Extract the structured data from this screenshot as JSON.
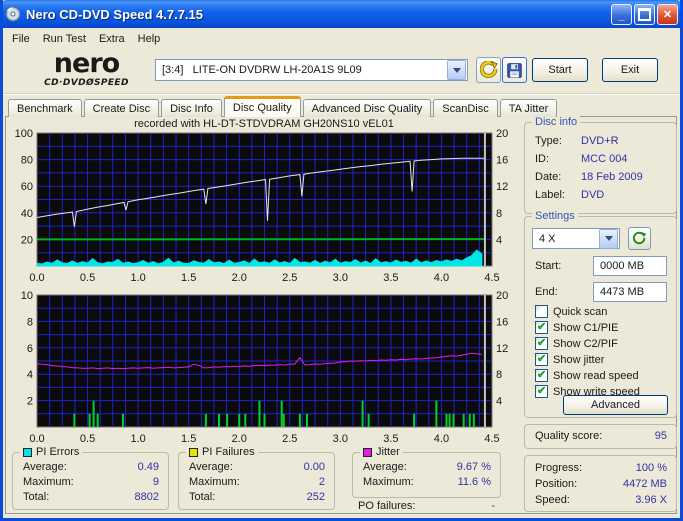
{
  "window": {
    "title": "Nero CD-DVD Speed 4.7.7.15"
  },
  "menu": {
    "items": [
      "File",
      "Run Test",
      "Extra",
      "Help"
    ]
  },
  "header": {
    "logo_title": "nero",
    "logo_subtitle": "CD·DVDØSPEED",
    "drive_select": "[3:4]   LITE-ON DVDRW LH-20A1S 9L09",
    "start_label": "Start",
    "exit_label": "Exit"
  },
  "tabs": {
    "items": [
      {
        "label": "Benchmark",
        "active": false
      },
      {
        "label": "Create Disc",
        "active": false
      },
      {
        "label": "Disc Info",
        "active": false
      },
      {
        "label": "Disc Quality",
        "active": true
      },
      {
        "label": "Advanced Disc Quality",
        "active": false
      },
      {
        "label": "ScanDisc",
        "active": false
      },
      {
        "label": "TA Jitter",
        "active": false
      }
    ]
  },
  "disc_info": {
    "caption": "Disc info",
    "rows": [
      {
        "label": "Type:",
        "value": "DVD+R"
      },
      {
        "label": "ID:",
        "value": "MCC 004"
      },
      {
        "label": "Date:",
        "value": "18 Feb 2009"
      },
      {
        "label": "Label:",
        "value": "DVD"
      }
    ]
  },
  "settings": {
    "caption": "Settings",
    "speed_value": "4 X",
    "start_label": "Start:",
    "start_value": "0000 MB",
    "end_label": "End:",
    "end_value": "4473 MB",
    "checkboxes": [
      {
        "label": "Quick scan",
        "checked": false
      },
      {
        "label": "Show C1/PIE",
        "checked": true
      },
      {
        "label": "Show C2/PIF",
        "checked": true
      },
      {
        "label": "Show jitter",
        "checked": true
      },
      {
        "label": "Show read speed",
        "checked": true
      },
      {
        "label": "Show write speed",
        "checked": true
      }
    ],
    "advanced_label": "Advanced"
  },
  "quality": {
    "label": "Quality score:",
    "value": "95"
  },
  "progress": {
    "rows": [
      {
        "label": "Progress:",
        "value": "100 %"
      },
      {
        "label": "Position:",
        "value": "4472 MB"
      },
      {
        "label": "Speed:",
        "value": "3.96 X"
      }
    ]
  },
  "stats": [
    {
      "caption": "PI Errors",
      "color": "#00e6e6",
      "rows": [
        {
          "label": "Average:",
          "value": "0.49"
        },
        {
          "label": "Maximum:",
          "value": "9"
        },
        {
          "label": "Total:",
          "value": "8802"
        }
      ]
    },
    {
      "caption": "PI Failures",
      "color": "#e8e400",
      "rows": [
        {
          "label": "Average:",
          "value": "0.00"
        },
        {
          "label": "Maximum:",
          "value": "2"
        },
        {
          "label": "Total:",
          "value": "252"
        }
      ]
    },
    {
      "caption": "Jitter",
      "color": "#e020e0",
      "rows": [
        {
          "label": "Average:",
          "value": "9.67 %"
        },
        {
          "label": "Maximum:",
          "value": "11.6 %"
        }
      ]
    }
  ],
  "po_failures": {
    "label": "PO failures:",
    "value": "-"
  },
  "chart_data": [
    {
      "type": "line",
      "title": "recorded with HL-DT-STDVDRAM GH20NS10 vEL01",
      "x": {
        "max": 4.5,
        "grid": 0.125,
        "label_step": 0.5
      },
      "left_axis": {
        "max": 100,
        "grid": 10,
        "label_step": 20,
        "label": "PI errors (left)"
      },
      "right_axis": {
        "max": 20,
        "label_step": 4,
        "label": "speed X (right)"
      },
      "cursor_x": 4.43,
      "grid_color": "#2222cf",
      "series": [
        {
          "name": "pi-errors",
          "kind": "area",
          "axis": "left",
          "color": "#00e6e6",
          "dx": 0.05,
          "values": [
            2,
            1.5,
            3,
            2,
            4.5,
            2.5,
            1.8,
            3.8,
            2,
            3.2,
            2.2,
            5.5,
            2.4,
            1.6,
            3,
            2.6,
            5,
            2,
            3,
            1.8,
            2.5,
            4.2,
            2,
            3.4,
            1.6,
            2.8,
            5.8,
            2.2,
            3.6,
            2,
            1.8,
            4,
            2.6,
            2,
            4.8,
            2.3,
            3,
            1.7,
            4.4,
            2,
            2.6,
            3.8,
            1.9,
            5.2,
            2.4,
            3.1,
            2,
            4.6,
            2.2,
            3.4,
            1.8,
            5.6,
            2.5,
            3,
            2.1,
            4.3,
            1.9,
            3.6,
            2.3,
            5,
            2,
            3.3,
            2.6,
            4.8,
            2.1,
            3.7,
            1.8,
            5.4,
            2.4,
            3.2,
            2.2,
            4.4,
            2.7,
            3.5,
            2,
            5.2,
            2.3,
            3.8,
            2.5,
            4.1,
            3,
            4.6,
            3.4,
            5,
            3.8,
            6,
            8,
            12,
            9
          ]
        },
        {
          "name": "read-speed",
          "kind": "line",
          "axis": "right",
          "color": "#00b41e",
          "width": 2,
          "points": [
            [
              0,
              4.0
            ],
            [
              1,
              4.0
            ],
            [
              2,
              4.02
            ],
            [
              3,
              4.03
            ],
            [
              4,
              4.05
            ],
            [
              4.43,
              4.05
            ]
          ]
        },
        {
          "name": "write-speed",
          "kind": "line",
          "axis": "right",
          "color": "#e6e6e6",
          "width": 1,
          "points": [
            [
              0,
              7.3
            ],
            [
              0.1,
              7.55
            ],
            [
              0.2,
              7.8
            ],
            [
              0.3,
              8.0
            ],
            [
              0.35,
              8.1
            ],
            [
              0.37,
              5.9
            ],
            [
              0.39,
              8.2
            ],
            [
              0.5,
              8.55
            ],
            [
              0.6,
              8.85
            ],
            [
              0.7,
              9.1
            ],
            [
              0.8,
              9.4
            ],
            [
              0.86,
              9.55
            ],
            [
              0.88,
              8.4
            ],
            [
              0.9,
              9.65
            ],
            [
              1.0,
              9.95
            ],
            [
              1.1,
              10.2
            ],
            [
              1.2,
              10.45
            ],
            [
              1.3,
              10.7
            ],
            [
              1.4,
              10.95
            ],
            [
              1.5,
              11.2
            ],
            [
              1.6,
              11.45
            ],
            [
              1.65,
              11.55
            ],
            [
              1.67,
              9.3
            ],
            [
              1.69,
              11.65
            ],
            [
              1.8,
              11.9
            ],
            [
              1.9,
              12.15
            ],
            [
              2.0,
              12.4
            ],
            [
              2.1,
              12.65
            ],
            [
              2.2,
              12.85
            ],
            [
              2.26,
              13.0
            ],
            [
              2.28,
              6.8
            ],
            [
              2.3,
              13.05
            ],
            [
              2.4,
              13.3
            ],
            [
              2.5,
              13.55
            ],
            [
              2.6,
              13.75
            ],
            [
              2.62,
              10.5
            ],
            [
              2.64,
              13.8
            ],
            [
              2.7,
              13.95
            ],
            [
              2.8,
              14.15
            ],
            [
              2.9,
              14.35
            ],
            [
              3.0,
              14.55
            ],
            [
              3.1,
              14.75
            ],
            [
              3.2,
              14.95
            ],
            [
              3.3,
              15.1
            ],
            [
              3.4,
              15.3
            ],
            [
              3.5,
              15.45
            ],
            [
              3.6,
              15.6
            ],
            [
              3.69,
              15.75
            ],
            [
              3.71,
              11.2
            ],
            [
              3.73,
              15.8
            ],
            [
              3.8,
              15.9
            ],
            [
              3.9,
              16.0
            ],
            [
              4.0,
              16.1
            ],
            [
              4.1,
              16.15
            ],
            [
              4.2,
              16.2
            ],
            [
              4.3,
              16.2
            ],
            [
              4.43,
              16.2
            ]
          ]
        }
      ]
    },
    {
      "type": "line",
      "title": "",
      "x": {
        "max": 4.5,
        "grid": 0.125,
        "label_step": 0.5
      },
      "left_axis": {
        "max": 10,
        "grid": 1,
        "label_step": 2,
        "label": "PI failures (left)"
      },
      "right_axis": {
        "max": 20,
        "label_step": 4,
        "label": "jitter % (right)"
      },
      "cursor_x": 4.43,
      "grid_color": "#2222cf",
      "series": [
        {
          "name": "pi-failures",
          "kind": "bars",
          "axis": "left",
          "color": "#00d232",
          "pairs": [
            [
              0.37,
              1
            ],
            [
              0.52,
              1
            ],
            [
              0.56,
              2
            ],
            [
              0.6,
              1
            ],
            [
              0.85,
              1
            ],
            [
              1.67,
              1
            ],
            [
              1.8,
              1
            ],
            [
              1.88,
              1
            ],
            [
              2.0,
              1
            ],
            [
              2.06,
              1
            ],
            [
              2.2,
              2
            ],
            [
              2.25,
              1
            ],
            [
              2.42,
              2
            ],
            [
              2.44,
              1
            ],
            [
              2.6,
              1
            ],
            [
              2.67,
              1
            ],
            [
              3.22,
              2
            ],
            [
              3.28,
              1
            ],
            [
              3.73,
              1
            ],
            [
              3.95,
              2
            ],
            [
              4.05,
              1
            ],
            [
              4.08,
              1
            ],
            [
              4.12,
              1
            ],
            [
              4.22,
              1
            ],
            [
              4.28,
              1
            ],
            [
              4.32,
              1
            ]
          ]
        },
        {
          "name": "jitter",
          "kind": "line",
          "axis": "right",
          "color": "#e020e0",
          "width": 1,
          "dx": 0.05,
          "values": [
            9.6,
            9.5,
            9.45,
            9.3,
            9.25,
            9.15,
            9.1,
            9.0,
            8.95,
            8.9,
            8.9,
            8.95,
            8.85,
            8.9,
            8.95,
            8.85,
            8.9,
            8.85,
            8.9,
            8.95,
            8.9,
            8.95,
            9.0,
            8.9,
            8.95,
            9.0,
            9.05,
            8.95,
            9.0,
            9.05,
            9.1,
            9.5,
            9.35,
            8.95,
            9.0,
            9.1,
            9.05,
            9.15,
            9.1,
            9.2,
            9.15,
            9.25,
            9.2,
            9.3,
            9.35,
            9.3,
            9.4,
            9.35,
            9.45,
            9.4,
            9.5,
            9.55,
            10.5,
            9.4,
            9.45,
            9.55,
            9.5,
            9.6,
            9.65,
            9.7,
            9.85,
            9.9,
            10.0,
            9.95,
            10.05,
            10.0,
            10.1,
            10.05,
            10.15,
            10.1,
            10.2,
            10.15,
            10.25,
            10.2,
            10.3,
            10.35,
            10.3,
            10.4,
            10.45,
            10.5,
            10.6,
            10.7,
            10.8,
            10.75,
            10.9,
            11.0,
            11.2,
            11.1,
            11.0
          ]
        }
      ]
    }
  ]
}
